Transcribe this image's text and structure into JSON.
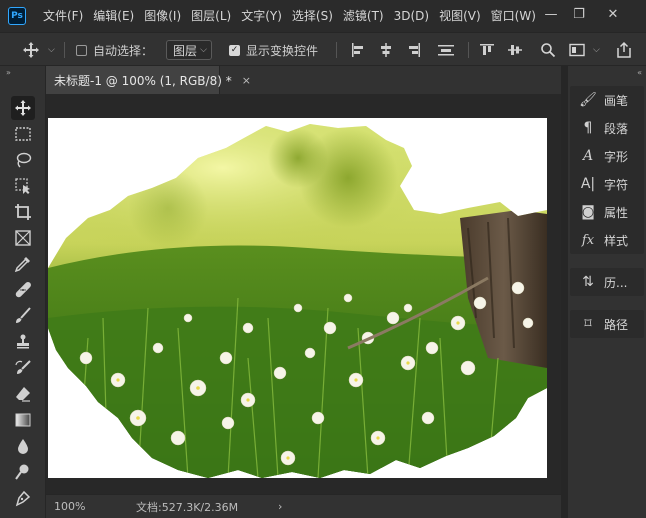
{
  "app": {
    "logo_text": "Ps"
  },
  "menubar": {
    "items": [
      "文件(F)",
      "编辑(E)",
      "图像(I)",
      "图层(L)",
      "文字(Y)",
      "选择(S)",
      "滤镜(T)",
      "3D(D)",
      "视图(V)",
      "窗口(W)"
    ]
  },
  "window_controls": {
    "minimize": "—",
    "restore": "❐",
    "close": "✕"
  },
  "options": {
    "auto_select_label": "自动选择：",
    "auto_select_checked": false,
    "auto_select_target": "图层",
    "show_transform_label": "显示变换控件",
    "show_transform_checked": true
  },
  "document": {
    "tab_title": "未标题-1 @ 100% (1, RGB/8) *",
    "close_glyph": "×"
  },
  "status": {
    "zoom": "100%",
    "doc_info": "文档:527.3K/2.36M",
    "arrow": "›"
  },
  "panels": {
    "group1": [
      {
        "icon": "brush-icon",
        "glyph": "🖌",
        "label": "画笔"
      },
      {
        "icon": "paragraph-icon",
        "glyph": "¶",
        "label": "段落"
      },
      {
        "icon": "character-icon",
        "glyph": "A",
        "label": "字形"
      },
      {
        "icon": "character-style-icon",
        "glyph": "A|",
        "label": "字符"
      },
      {
        "icon": "properties-icon",
        "glyph": "◙",
        "label": "属性"
      },
      {
        "icon": "fx-icon",
        "glyph": "fx",
        "label": "样式"
      }
    ],
    "group2": [
      {
        "icon": "history-icon",
        "glyph": "⇅",
        "label": "历..."
      }
    ],
    "group3": [
      {
        "icon": "paths-icon",
        "glyph": "⌑",
        "label": "路径"
      }
    ]
  },
  "colors": {
    "menubar_bg": "#2b2b2b",
    "workspace_bg": "#323232",
    "pasteboard_bg": "#282828",
    "canvas_bg": "#ffffff",
    "accent": "#31a8ff"
  }
}
